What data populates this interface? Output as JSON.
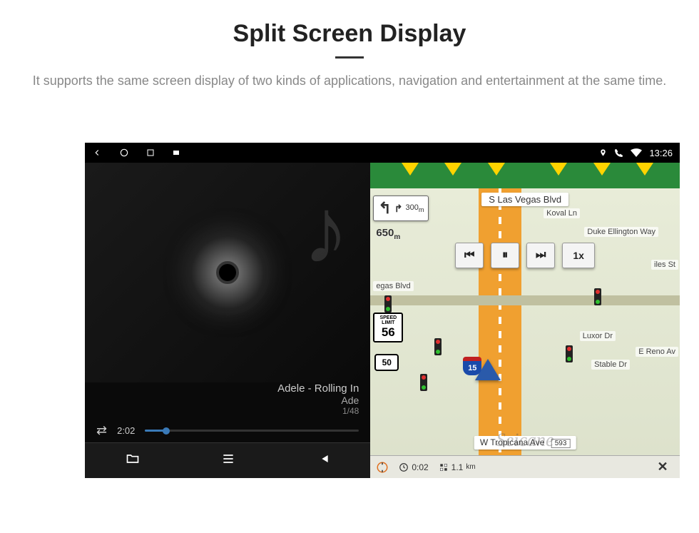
{
  "page": {
    "title": "Split Screen Display",
    "subtitle": "It supports the same screen display of two kinds of applications, navigation and entertainment at the same time."
  },
  "statusbar": {
    "time": "13:26",
    "icons": {
      "location": "location-icon",
      "phone": "phone-icon",
      "wifi": "wifi-icon"
    }
  },
  "music": {
    "track_title": "Adele - Rolling In",
    "track_artist": "Ade",
    "track_index": "1/48",
    "elapsed": "2:02",
    "bottom": {
      "folder": "folder-icon",
      "playlist": "playlist-icon",
      "prev": "prev-icon"
    }
  },
  "map": {
    "street_top": "S Las Vegas Blvd",
    "turn": {
      "next_dist": "300",
      "next_unit": "m",
      "main_dist": "650",
      "main_unit": "m"
    },
    "controls": {
      "prev": "⏮",
      "pause": "⏸",
      "next": "⏭",
      "speed": "1x"
    },
    "labels": {
      "vegas_blvd": "egas Blvd",
      "koval": "Koval Ln",
      "duke": "Duke Ellington Way",
      "iles": "iles St",
      "luxor": "Luxor Dr",
      "reno": "E Reno Av",
      "stable": "Stable Dr"
    },
    "speed_limit": {
      "label": "SPEED LIMIT",
      "value": "56"
    },
    "route_shield": "50",
    "interstate": "15",
    "street_bottom": "W Tropicana Ave",
    "street_bottom_pin": "593",
    "bottom": {
      "time": "0:02",
      "dist": "1.1",
      "dist_unit": "km"
    },
    "watermark": "Seicane"
  }
}
